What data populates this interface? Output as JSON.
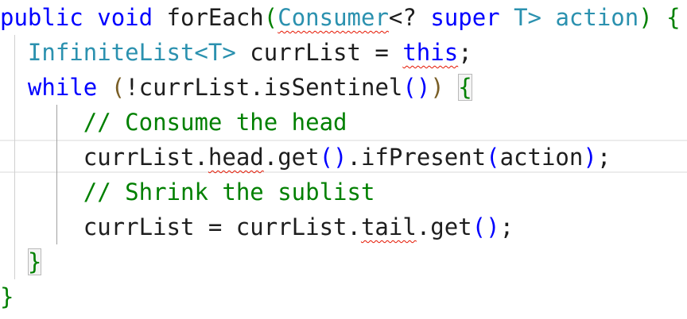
{
  "editor": {
    "lines": [
      {
        "tokens": [
          {
            "text": "public",
            "kind": "keyword"
          },
          {
            "text": " ",
            "kind": "text"
          },
          {
            "text": "void",
            "kind": "keyword"
          },
          {
            "text": " forEach",
            "kind": "text"
          },
          {
            "text": "(",
            "kind": "paren"
          },
          {
            "text": "Consumer",
            "kind": "type-squiggle"
          },
          {
            "text": "<? ",
            "kind": "text"
          },
          {
            "text": "super",
            "kind": "keyword"
          },
          {
            "text": " T> action",
            "kind": "type"
          },
          {
            "text": ")",
            "kind": "paren"
          },
          {
            "text": " ",
            "kind": "text"
          },
          {
            "text": "{",
            "kind": "brace"
          }
        ]
      },
      {
        "tokens": [
          {
            "text": "  ",
            "kind": "text"
          },
          {
            "text": "InfiniteList<T>",
            "kind": "type"
          },
          {
            "text": " currList = ",
            "kind": "text"
          },
          {
            "text": "this",
            "kind": "keyword-squiggle"
          },
          {
            "text": ";",
            "kind": "text"
          }
        ]
      },
      {
        "tokens": [
          {
            "text": "  ",
            "kind": "text"
          },
          {
            "text": "while",
            "kind": "keyword"
          },
          {
            "text": " ",
            "kind": "text"
          },
          {
            "text": "(",
            "kind": "paren-brown"
          },
          {
            "text": "!currList.isSentinel",
            "kind": "text"
          },
          {
            "text": "()",
            "kind": "paren-blue"
          },
          {
            "text": ")",
            "kind": "paren-brown"
          },
          {
            "text": " ",
            "kind": "text"
          },
          {
            "text": "{",
            "kind": "brace-boxed"
          }
        ]
      },
      {
        "tokens": [
          {
            "text": "      ",
            "kind": "text"
          },
          {
            "text": "// Consume the head",
            "kind": "comment"
          }
        ]
      },
      {
        "tokens": [
          {
            "text": "      currList.",
            "kind": "text"
          },
          {
            "text": "head",
            "kind": "text-squiggle"
          },
          {
            "text": ".get",
            "kind": "text"
          },
          {
            "text": "()",
            "kind": "paren-blue"
          },
          {
            "text": ".ifPresent",
            "kind": "text"
          },
          {
            "text": "(",
            "kind": "paren-blue"
          },
          {
            "text": "action",
            "kind": "text"
          },
          {
            "text": ")",
            "kind": "paren-blue"
          },
          {
            "text": ";",
            "kind": "text"
          }
        ]
      },
      {
        "tokens": [
          {
            "text": "      ",
            "kind": "text"
          },
          {
            "text": "// Shrink the sublist",
            "kind": "comment"
          }
        ]
      },
      {
        "tokens": [
          {
            "text": "      currList = currList.",
            "kind": "text"
          },
          {
            "text": "tail",
            "kind": "text-squiggle"
          },
          {
            "text": ".get",
            "kind": "text"
          },
          {
            "text": "()",
            "kind": "paren-blue"
          },
          {
            "text": ";",
            "kind": "text"
          }
        ]
      },
      {
        "tokens": [
          {
            "text": "  ",
            "kind": "text"
          },
          {
            "text": "}",
            "kind": "brace-boxed"
          }
        ]
      },
      {
        "tokens": [
          {
            "text": "}",
            "kind": "brace"
          }
        ]
      }
    ]
  },
  "colors": {
    "keyword": "#0000ff",
    "type": "#2b91af",
    "comment": "#008000",
    "text": "#1e1e1e",
    "error_squiggle": "#e51400"
  }
}
